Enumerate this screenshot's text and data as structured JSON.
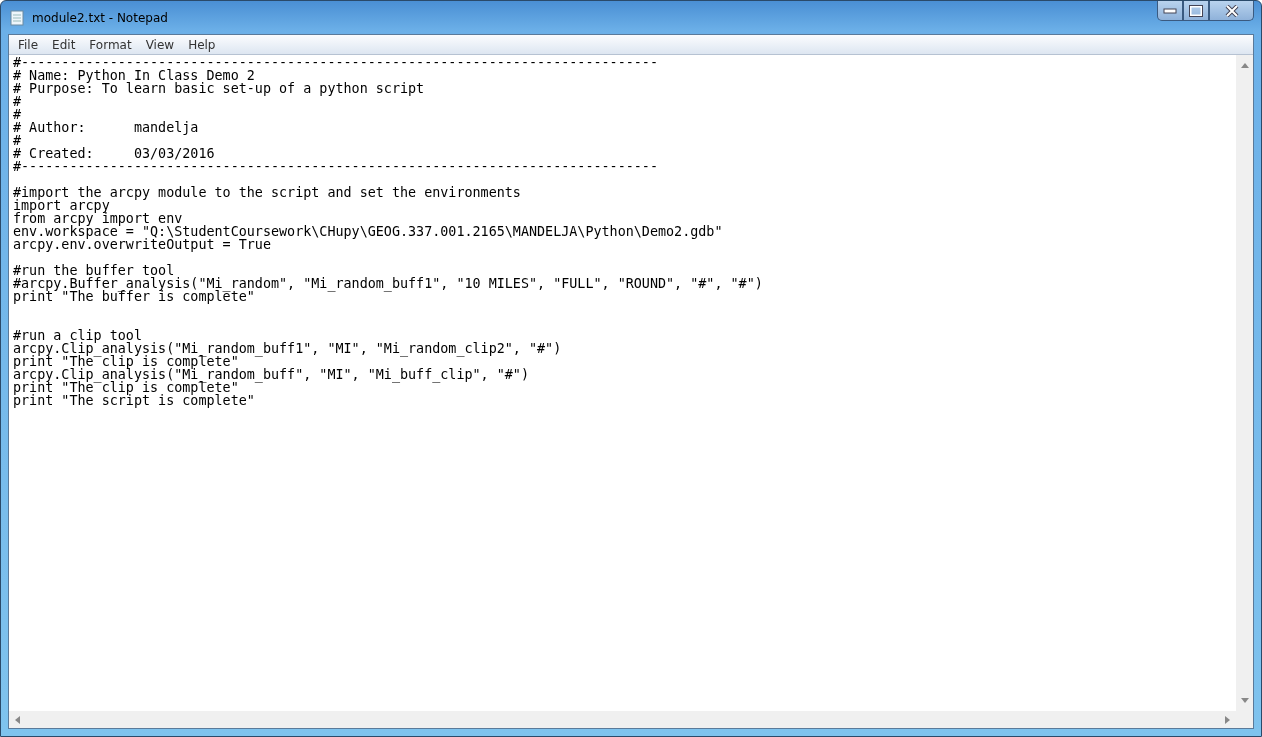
{
  "window": {
    "title": "module2.txt - Notepad"
  },
  "menu": [
    {
      "label": "File"
    },
    {
      "label": "Edit"
    },
    {
      "label": "Format"
    },
    {
      "label": "View"
    },
    {
      "label": "Help"
    }
  ],
  "editor": {
    "lines": [
      {
        "kind": "code",
        "text": "#-------------------------------------------------------------------------------"
      },
      {
        "kind": "code",
        "text": "# Name: Python In Class Demo 2"
      },
      {
        "kind": "code",
        "text": "# Purpose: To learn basic set-up of a python script"
      },
      {
        "kind": "code",
        "text": "#"
      },
      {
        "kind": "code",
        "text": "#"
      },
      {
        "kind": "code",
        "text": "# Author:      mandelja"
      },
      {
        "kind": "code",
        "text": "#"
      },
      {
        "kind": "code",
        "text": "# Created:     03/03/2016"
      },
      {
        "kind": "code",
        "text": "#-------------------------------------------------------------------------------"
      },
      {
        "kind": "blank"
      },
      {
        "kind": "code",
        "text": "#import the arcpy module to the script and set the environments"
      },
      {
        "kind": "code",
        "text": "import arcpy"
      },
      {
        "kind": "code",
        "text": "from arcpy import env"
      },
      {
        "kind": "code",
        "text": "env.workspace = \"Q:\\StudentCoursework\\CHupy\\GEOG.337.001.2165\\MANDELJA\\Python\\Demo2.gdb\""
      },
      {
        "kind": "code",
        "text": "arcpy.env.overwriteOutput = True"
      },
      {
        "kind": "blank"
      },
      {
        "kind": "code",
        "text": "#run the buffer tool"
      },
      {
        "kind": "code",
        "text": "#arcpy.Buffer_analysis(\"Mi_random\", \"Mi_random_buff1\", \"10 MILES\", \"FULL\", \"ROUND\", \"#\", \"#\")"
      },
      {
        "kind": "code",
        "text": "print \"The buffer is complete\""
      },
      {
        "kind": "blank"
      },
      {
        "kind": "blank"
      },
      {
        "kind": "code",
        "text": "#run a clip tool"
      },
      {
        "kind": "code",
        "text": "arcpy.Clip_analysis(\"Mi_random_buff1\", \"MI\", \"Mi_random_clip2\", \"#\")"
      },
      {
        "kind": "code",
        "text": "print \"The clip is complete\""
      },
      {
        "kind": "code",
        "text": "arcpy.Clip_analysis(\"Mi_random_buff\", \"MI\", \"Mi_buff_clip\", \"#\")"
      },
      {
        "kind": "code",
        "text": "print \"The clip is complete\""
      },
      {
        "kind": "code",
        "text": "print \"The script is complete\""
      }
    ]
  }
}
